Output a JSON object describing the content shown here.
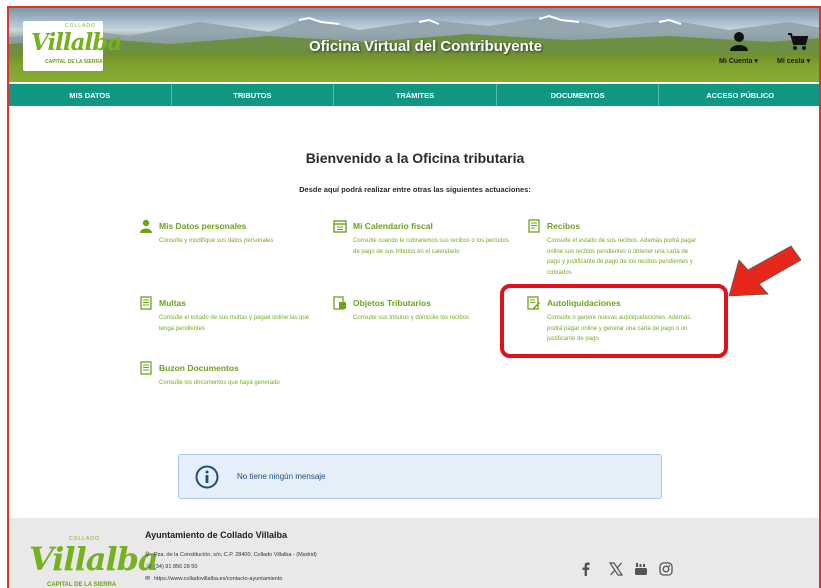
{
  "header": {
    "logo": {
      "top": "COLLADO",
      "main": "Villalba",
      "sub": "CAPITAL DE LA SIERRA"
    },
    "title": "Oficina Virtual del Contribuyente",
    "account_label": "Mi Cuenta ▾",
    "cart_label": "Mi cesta ▾"
  },
  "nav": [
    "MIS DATOS",
    "TRIBUTOS",
    "TRÁMITES",
    "DOCUMENTOS",
    "ACCESO PÚBLICO"
  ],
  "main": {
    "welcome": "Bienvenido a la Oficina tributaria",
    "intro": "Desde aquí podrá realizar entre otras las siguientes actuaciones:",
    "cards": [
      {
        "title": "Mis Datos personales",
        "desc": "Consulte y modifique sus datos personales",
        "icon": "user-icon"
      },
      {
        "title": "Mi Calendario fiscal",
        "desc": "Consulte cuando le cobraremos sus recibos o los periodos de pago de sus tributos en el calendario",
        "icon": "calendar-icon"
      },
      {
        "title": "Recibos",
        "desc": "Consulte el estado de sus recibos. Además podrá pagar online sus recibos pendientes o obtener una carta de pago y justificante de pago de los recibos pendientes y cobrados",
        "icon": "receipt-icon"
      },
      {
        "title": "Multas",
        "desc": "Consulte el estado de sus multas y pague online las que tenga pendientes",
        "icon": "fine-icon"
      },
      {
        "title": "Objetos Tributarios",
        "desc": "Consulte sus tributos y domicilie los recibos",
        "icon": "tax-object-icon"
      },
      {
        "title": "Autoliquidaciones",
        "desc": "Consulte o genere nuevas autoliquidaciones. Además, podrá pagar online y generar una carta de pago o un justificante de pago",
        "icon": "self-assessment-icon"
      },
      {
        "title": "Buzon Documentos",
        "desc": "Consulte los documentos que haya generado",
        "icon": "document-icon"
      }
    ],
    "message": "No tiene ningún mensaje"
  },
  "footer": {
    "title": "Ayuntamiento de Collado Villalba",
    "address": "Pza. de la Constitución, s/n, C.P. 28400, Collado Villalba - (Madrid)",
    "phone": "(34) 91 856 28 50",
    "web": "https://www.colladovillalba.es/contacto-ayuntamiento",
    "social": [
      "facebook-icon",
      "x-icon",
      "youtube-icon",
      "instagram-icon"
    ]
  },
  "colors": {
    "accent": "#0f9784",
    "link": "#6da31b",
    "highlight": "#e1111c"
  }
}
